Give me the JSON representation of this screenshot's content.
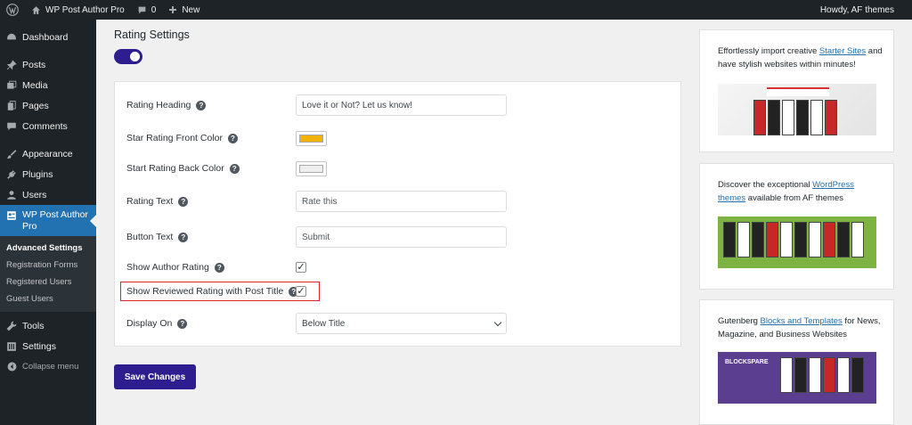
{
  "adminbar": {
    "site_name": "WP Post Author Pro",
    "comments_count": "0",
    "new_label": "New",
    "howdy": "Howdy, AF themes"
  },
  "sidebar": {
    "items": [
      {
        "label": "Dashboard",
        "icon": "dashboard-icon"
      },
      {
        "label": "Posts",
        "icon": "pin-icon"
      },
      {
        "label": "Media",
        "icon": "media-icon"
      },
      {
        "label": "Pages",
        "icon": "pages-icon"
      },
      {
        "label": "Comments",
        "icon": "comments-icon"
      },
      {
        "label": "Appearance",
        "icon": "brush-icon"
      },
      {
        "label": "Plugins",
        "icon": "plugin-icon"
      },
      {
        "label": "Users",
        "icon": "users-icon"
      },
      {
        "label": "WP Post Author Pro",
        "icon": "author-icon"
      },
      {
        "label": "Tools",
        "icon": "wrench-icon"
      },
      {
        "label": "Settings",
        "icon": "settings-icon"
      },
      {
        "label": "Collapse menu",
        "icon": "collapse-icon"
      }
    ],
    "submenu": [
      "Advanced Settings",
      "Registration Forms",
      "Registered Users",
      "Guest Users"
    ]
  },
  "main": {
    "section_title": "Rating Settings",
    "toggle_on": true,
    "fields": {
      "rating_heading": {
        "label": "Rating Heading",
        "value": "Love it or Not? Let us know!"
      },
      "star_front": {
        "label": "Star Rating Front Color",
        "color": "#f0b400"
      },
      "star_back": {
        "label": "Start Rating Back Color",
        "color": "#eeeeee"
      },
      "rating_text": {
        "label": "Rating Text",
        "placeholder": "Rate this"
      },
      "button_text": {
        "label": "Button Text",
        "placeholder": "Submit"
      },
      "show_author_rating": {
        "label": "Show Author Rating",
        "checked": true,
        "mark": "✓"
      },
      "show_reviewed": {
        "label": "Show Reviewed Rating with Post Title",
        "checked": true,
        "mark": "✓"
      },
      "display_on": {
        "label": "Display On",
        "value": "Below Title"
      }
    },
    "help_glyph": "?",
    "save_label": "Save Changes"
  },
  "widgets": [
    {
      "before": "Effortlessly import creative ",
      "link": "Starter Sites",
      "after": " and have stylish websites within minutes!"
    },
    {
      "before": "Discover the exceptional ",
      "link": "WordPress themes",
      "after": " available from AF themes"
    },
    {
      "before": "Gutenberg ",
      "link": "Blocks and Templates",
      "after": " for News, Magazine, and Business Websites",
      "logo": "BLOCKSPARE"
    }
  ],
  "colors": {
    "accent": "#2e1d8e",
    "wp_blue": "#2271b1",
    "highlight": "#e02424"
  }
}
